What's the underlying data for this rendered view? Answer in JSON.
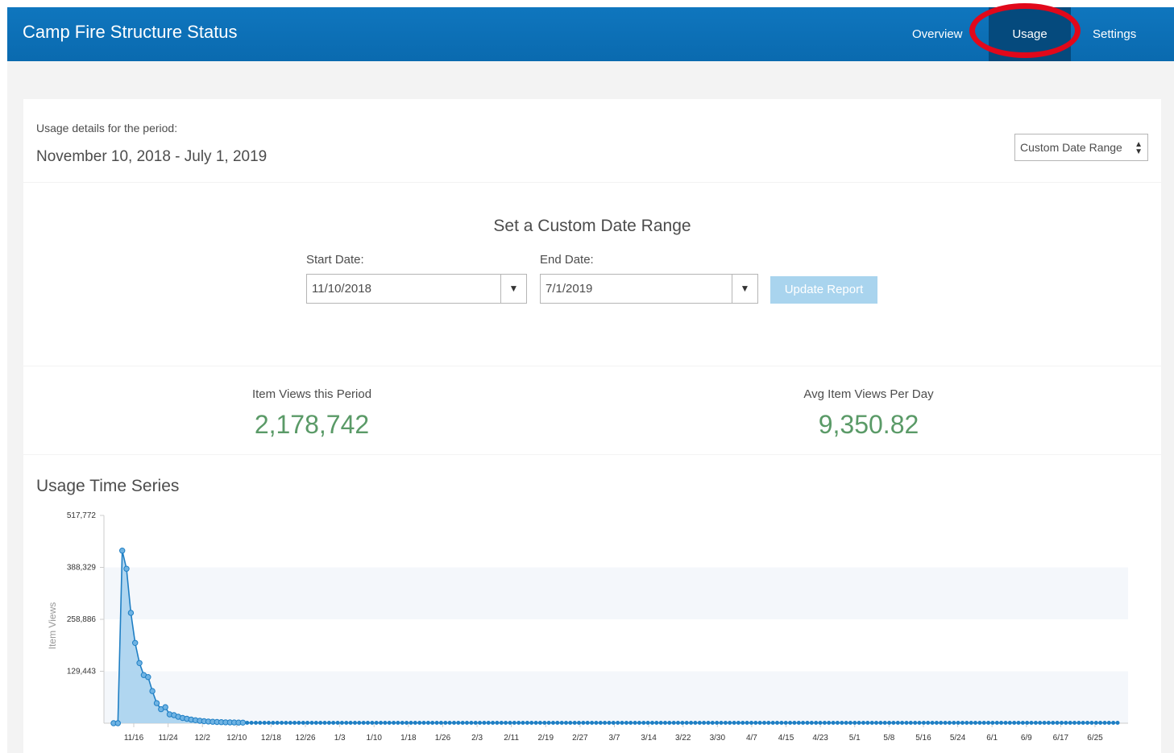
{
  "header": {
    "title": "Camp Fire Structure Status",
    "nav": [
      "Overview",
      "Usage",
      "Settings"
    ],
    "active_nav": "Usage",
    "highlight_color": "#e1081a"
  },
  "period": {
    "label": "Usage details for the period:",
    "dates": "November 10, 2018 - July 1, 2019",
    "range_select": "Custom Date Range"
  },
  "custom_range": {
    "heading": "Set a Custom Date Range",
    "start_label": "Start Date:",
    "start_value": "11/10/2018",
    "end_label": "End Date:",
    "end_value": "7/1/2019",
    "update_button": "Update Report"
  },
  "stats": {
    "views_label": "Item Views this Period",
    "views_value": "2,178,742",
    "avg_label": "Avg Item Views Per Day",
    "avg_value": "9,350.82",
    "value_color": "#5a9a67"
  },
  "chart_title": "Usage Time Series",
  "chart_data": {
    "type": "area",
    "ylabel": "Item Views",
    "ylim": [
      0,
      517772
    ],
    "y_ticks": [
      "517,772",
      "388,329",
      "258,886",
      "129,443"
    ],
    "y_tick_values": [
      517772,
      388329,
      258886,
      129443
    ],
    "x_ticks": [
      "11/16",
      "11/24",
      "12/2",
      "12/10",
      "12/18",
      "12/26",
      "1/3",
      "1/10",
      "1/18",
      "1/26",
      "2/3",
      "2/11",
      "2/19",
      "2/27",
      "3/7",
      "3/14",
      "3/22",
      "3/30",
      "4/7",
      "4/15",
      "4/23",
      "5/1",
      "5/8",
      "5/16",
      "5/24",
      "6/1",
      "6/9",
      "6/17",
      "6/25"
    ],
    "series": [
      {
        "x": [
          "2018-11-10",
          "2018-11-11",
          "2018-11-12",
          "2018-11-13",
          "2018-11-14",
          "2018-11-15",
          "2018-11-16",
          "2018-11-17",
          "2018-11-18",
          "2018-11-19",
          "2018-11-20",
          "2018-11-21",
          "2018-11-22",
          "2018-11-23",
          "2018-11-24",
          "2018-11-25",
          "2018-11-26",
          "2018-11-27",
          "2018-11-28",
          "2018-11-29",
          "2018-11-30",
          "2018-12-01",
          "2018-12-02",
          "2018-12-03",
          "2018-12-04",
          "2018-12-05",
          "2018-12-06",
          "2018-12-07",
          "2018-12-08",
          "2018-12-09",
          "2018-12-10"
        ],
        "values": [
          0,
          0,
          430000,
          385000,
          275000,
          200000,
          150000,
          120000,
          115000,
          80000,
          50000,
          35000,
          40000,
          22000,
          20000,
          16000,
          13000,
          11000,
          9000,
          7500,
          6000,
          5000,
          4200,
          3600,
          3000,
          2600,
          2300,
          2000,
          1800,
          1600,
          1500
        ]
      }
    ],
    "baseline_value": 1000,
    "x_end": "2019-07-01",
    "color": "#1f7fc4",
    "fill": "#a9d1ee",
    "grid_bands": true
  }
}
